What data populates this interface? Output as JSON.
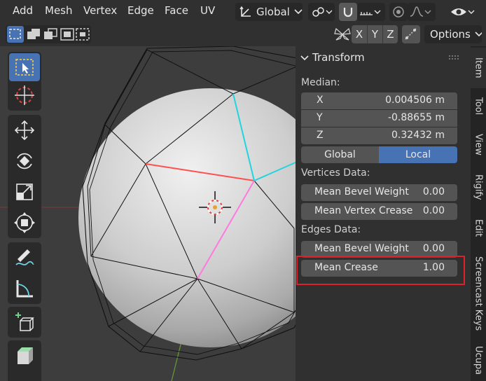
{
  "menu": {
    "items": [
      "Add",
      "Mesh",
      "Vertex",
      "Edge",
      "Face",
      "UV"
    ],
    "orientation": "Global"
  },
  "toolbar2": {
    "axes": [
      "X",
      "Y",
      "Z"
    ],
    "options_label": "Options"
  },
  "panel": {
    "title": "Transform",
    "median_label": "Median:",
    "x_label": "X",
    "x_value": "0.004506 m",
    "y_label": "Y",
    "y_value": "-0.88655 m",
    "z_label": "Z",
    "z_value": "0.32432 m",
    "global_label": "Global",
    "local_label": "Local",
    "vertices_data_label": "Vertices Data:",
    "v_bevel_label": "Mean Bevel Weight",
    "v_bevel_value": "0.00",
    "v_crease_label": "Mean Vertex Crease",
    "v_crease_value": "0.00",
    "edges_data_label": "Edges Data:",
    "e_bevel_label": "Mean Bevel Weight",
    "e_bevel_value": "0.00",
    "e_crease_label": "Mean Crease",
    "e_crease_value": "1.00"
  },
  "tabs": [
    "Item",
    "Tool",
    "View",
    "Rigify",
    "Edit",
    "Screencast Keys",
    "Ucupa"
  ],
  "colors": {
    "accent": "#4772b3",
    "highlight_box": "#e0202a",
    "seam_edge": "#ff4f4f",
    "crease_edge": "#ff7adf",
    "selected_edge": "#22d4e0"
  }
}
